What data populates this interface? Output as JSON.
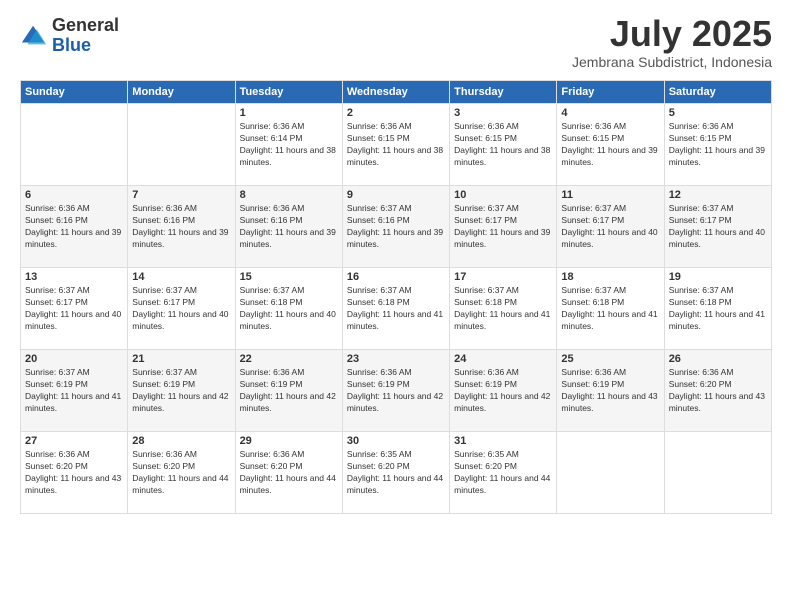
{
  "logo": {
    "general": "General",
    "blue": "Blue"
  },
  "header": {
    "title": "July 2025",
    "location": "Jembrana Subdistrict, Indonesia"
  },
  "weekdays": [
    "Sunday",
    "Monday",
    "Tuesday",
    "Wednesday",
    "Thursday",
    "Friday",
    "Saturday"
  ],
  "weeks": [
    [
      {
        "day": "",
        "sunrise": "",
        "sunset": "",
        "daylight": ""
      },
      {
        "day": "",
        "sunrise": "",
        "sunset": "",
        "daylight": ""
      },
      {
        "day": "1",
        "sunrise": "Sunrise: 6:36 AM",
        "sunset": "Sunset: 6:14 PM",
        "daylight": "Daylight: 11 hours and 38 minutes."
      },
      {
        "day": "2",
        "sunrise": "Sunrise: 6:36 AM",
        "sunset": "Sunset: 6:15 PM",
        "daylight": "Daylight: 11 hours and 38 minutes."
      },
      {
        "day": "3",
        "sunrise": "Sunrise: 6:36 AM",
        "sunset": "Sunset: 6:15 PM",
        "daylight": "Daylight: 11 hours and 38 minutes."
      },
      {
        "day": "4",
        "sunrise": "Sunrise: 6:36 AM",
        "sunset": "Sunset: 6:15 PM",
        "daylight": "Daylight: 11 hours and 39 minutes."
      },
      {
        "day": "5",
        "sunrise": "Sunrise: 6:36 AM",
        "sunset": "Sunset: 6:15 PM",
        "daylight": "Daylight: 11 hours and 39 minutes."
      }
    ],
    [
      {
        "day": "6",
        "sunrise": "Sunrise: 6:36 AM",
        "sunset": "Sunset: 6:16 PM",
        "daylight": "Daylight: 11 hours and 39 minutes."
      },
      {
        "day": "7",
        "sunrise": "Sunrise: 6:36 AM",
        "sunset": "Sunset: 6:16 PM",
        "daylight": "Daylight: 11 hours and 39 minutes."
      },
      {
        "day": "8",
        "sunrise": "Sunrise: 6:36 AM",
        "sunset": "Sunset: 6:16 PM",
        "daylight": "Daylight: 11 hours and 39 minutes."
      },
      {
        "day": "9",
        "sunrise": "Sunrise: 6:37 AM",
        "sunset": "Sunset: 6:16 PM",
        "daylight": "Daylight: 11 hours and 39 minutes."
      },
      {
        "day": "10",
        "sunrise": "Sunrise: 6:37 AM",
        "sunset": "Sunset: 6:17 PM",
        "daylight": "Daylight: 11 hours and 39 minutes."
      },
      {
        "day": "11",
        "sunrise": "Sunrise: 6:37 AM",
        "sunset": "Sunset: 6:17 PM",
        "daylight": "Daylight: 11 hours and 40 minutes."
      },
      {
        "day": "12",
        "sunrise": "Sunrise: 6:37 AM",
        "sunset": "Sunset: 6:17 PM",
        "daylight": "Daylight: 11 hours and 40 minutes."
      }
    ],
    [
      {
        "day": "13",
        "sunrise": "Sunrise: 6:37 AM",
        "sunset": "Sunset: 6:17 PM",
        "daylight": "Daylight: 11 hours and 40 minutes."
      },
      {
        "day": "14",
        "sunrise": "Sunrise: 6:37 AM",
        "sunset": "Sunset: 6:17 PM",
        "daylight": "Daylight: 11 hours and 40 minutes."
      },
      {
        "day": "15",
        "sunrise": "Sunrise: 6:37 AM",
        "sunset": "Sunset: 6:18 PM",
        "daylight": "Daylight: 11 hours and 40 minutes."
      },
      {
        "day": "16",
        "sunrise": "Sunrise: 6:37 AM",
        "sunset": "Sunset: 6:18 PM",
        "daylight": "Daylight: 11 hours and 41 minutes."
      },
      {
        "day": "17",
        "sunrise": "Sunrise: 6:37 AM",
        "sunset": "Sunset: 6:18 PM",
        "daylight": "Daylight: 11 hours and 41 minutes."
      },
      {
        "day": "18",
        "sunrise": "Sunrise: 6:37 AM",
        "sunset": "Sunset: 6:18 PM",
        "daylight": "Daylight: 11 hours and 41 minutes."
      },
      {
        "day": "19",
        "sunrise": "Sunrise: 6:37 AM",
        "sunset": "Sunset: 6:18 PM",
        "daylight": "Daylight: 11 hours and 41 minutes."
      }
    ],
    [
      {
        "day": "20",
        "sunrise": "Sunrise: 6:37 AM",
        "sunset": "Sunset: 6:19 PM",
        "daylight": "Daylight: 11 hours and 41 minutes."
      },
      {
        "day": "21",
        "sunrise": "Sunrise: 6:37 AM",
        "sunset": "Sunset: 6:19 PM",
        "daylight": "Daylight: 11 hours and 42 minutes."
      },
      {
        "day": "22",
        "sunrise": "Sunrise: 6:36 AM",
        "sunset": "Sunset: 6:19 PM",
        "daylight": "Daylight: 11 hours and 42 minutes."
      },
      {
        "day": "23",
        "sunrise": "Sunrise: 6:36 AM",
        "sunset": "Sunset: 6:19 PM",
        "daylight": "Daylight: 11 hours and 42 minutes."
      },
      {
        "day": "24",
        "sunrise": "Sunrise: 6:36 AM",
        "sunset": "Sunset: 6:19 PM",
        "daylight": "Daylight: 11 hours and 42 minutes."
      },
      {
        "day": "25",
        "sunrise": "Sunrise: 6:36 AM",
        "sunset": "Sunset: 6:19 PM",
        "daylight": "Daylight: 11 hours and 43 minutes."
      },
      {
        "day": "26",
        "sunrise": "Sunrise: 6:36 AM",
        "sunset": "Sunset: 6:20 PM",
        "daylight": "Daylight: 11 hours and 43 minutes."
      }
    ],
    [
      {
        "day": "27",
        "sunrise": "Sunrise: 6:36 AM",
        "sunset": "Sunset: 6:20 PM",
        "daylight": "Daylight: 11 hours and 43 minutes."
      },
      {
        "day": "28",
        "sunrise": "Sunrise: 6:36 AM",
        "sunset": "Sunset: 6:20 PM",
        "daylight": "Daylight: 11 hours and 44 minutes."
      },
      {
        "day": "29",
        "sunrise": "Sunrise: 6:36 AM",
        "sunset": "Sunset: 6:20 PM",
        "daylight": "Daylight: 11 hours and 44 minutes."
      },
      {
        "day": "30",
        "sunrise": "Sunrise: 6:35 AM",
        "sunset": "Sunset: 6:20 PM",
        "daylight": "Daylight: 11 hours and 44 minutes."
      },
      {
        "day": "31",
        "sunrise": "Sunrise: 6:35 AM",
        "sunset": "Sunset: 6:20 PM",
        "daylight": "Daylight: 11 hours and 44 minutes."
      },
      {
        "day": "",
        "sunrise": "",
        "sunset": "",
        "daylight": ""
      },
      {
        "day": "",
        "sunrise": "",
        "sunset": "",
        "daylight": ""
      }
    ]
  ]
}
